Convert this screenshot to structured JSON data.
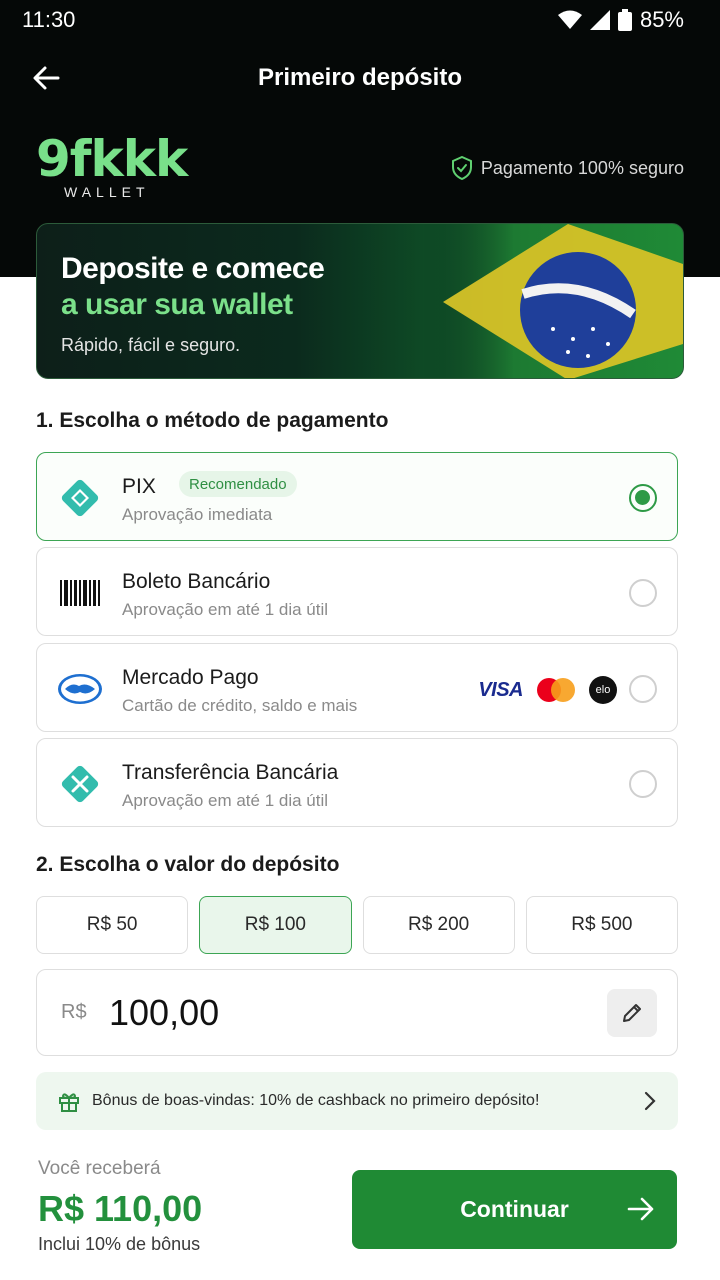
{
  "status_bar": {
    "time": "11:30",
    "battery": "85%"
  },
  "appbar": {
    "title": "Primeiro depósito"
  },
  "brand": {
    "logo": "9fkkk",
    "sub": "WALLET",
    "secure_text": "Pagamento 100% seguro"
  },
  "banner": {
    "line1": "Deposite e comece",
    "line2": "a usar sua wallet",
    "subtitle": "Rápido, fácil e seguro."
  },
  "step1": {
    "title": "1. Escolha o método de pagamento"
  },
  "methods": [
    {
      "name": "PIX",
      "badge": "Recomendado",
      "desc": "Aprovação imediata",
      "icon": "pix-icon",
      "selected": true
    },
    {
      "name": "Boleto Bancário",
      "desc": "Aprovação em até 1 dia útil",
      "icon": "barcode-icon",
      "selected": false
    },
    {
      "name": "Mercado Pago",
      "desc": "Cartão de crédito, saldo e mais",
      "icon": "handshake-icon",
      "selected": false,
      "cards": [
        "VISA",
        "mastercard",
        "elo"
      ]
    },
    {
      "name": "Transferência Bancária",
      "desc": "Aprovação em até 1 dia útil",
      "icon": "transfer-icon",
      "selected": false
    }
  ],
  "step2": {
    "title": "2. Escolha o valor do depósito"
  },
  "amounts": [
    {
      "label": "R$ 50",
      "selected": false
    },
    {
      "label": "R$ 100",
      "selected": true
    },
    {
      "label": "R$ 200",
      "selected": false
    },
    {
      "label": "R$ 500",
      "selected": false
    }
  ],
  "value_input": {
    "currency": "R$",
    "value": "100,00"
  },
  "bonus": {
    "text": "Bônus de boas-vindas: 10% de cashback no primeiro depósito!"
  },
  "summary": {
    "label": "Você receberá",
    "total": "R$ 110,00",
    "note": "Inclui 10% de bônus"
  },
  "cta": {
    "label": "Continuar"
  },
  "colors": {
    "accent": "#1f8a34",
    "brand_green": "#79e08a",
    "header_bg": "#050807"
  }
}
